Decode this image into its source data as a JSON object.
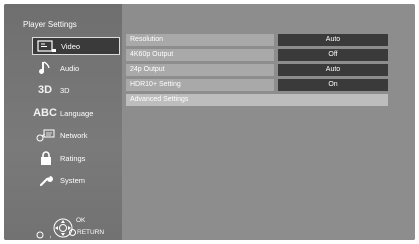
{
  "title": "Player Settings",
  "nav": [
    {
      "label": "Video",
      "icon": "video-icon"
    },
    {
      "label": "Audio",
      "icon": "audio-icon"
    },
    {
      "label": "3D",
      "icon_text": "3D"
    },
    {
      "label": "Language",
      "icon_text": "ABC"
    },
    {
      "label": "Network",
      "icon": "network-icon"
    },
    {
      "label": "Ratings",
      "icon": "lock-icon"
    },
    {
      "label": "System",
      "icon": "wrench-icon"
    }
  ],
  "settings": [
    {
      "label": "Resolution",
      "value": "Auto"
    },
    {
      "label": "4K60p Output",
      "value": "Off"
    },
    {
      "label": "24p Output",
      "value": "Auto"
    },
    {
      "label": "HDR10+ Setting",
      "value": "On"
    },
    {
      "label": "Advanced Settings"
    }
  ],
  "controls": {
    "ok": "OK",
    "return": "RETURN"
  }
}
